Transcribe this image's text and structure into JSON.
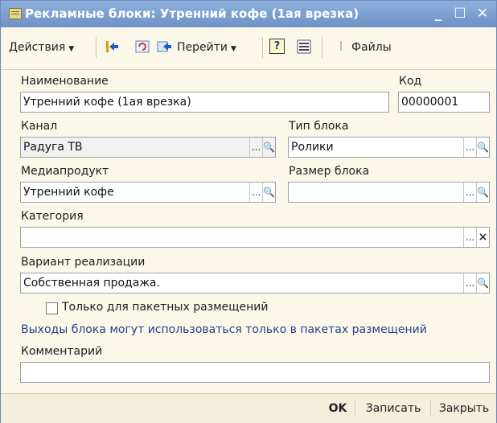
{
  "window": {
    "title": "Рекламные блоки: Утренний кофе (1ая врезка)"
  },
  "titlebar": {
    "minimize_glyph": "_",
    "maximize_glyph": "☐",
    "close_glyph": "✕"
  },
  "toolbar": {
    "actions_label": "Действия",
    "goto_label": "Перейти",
    "help_glyph": "?",
    "files_label": "Файлы"
  },
  "form": {
    "name_label": "Наименование",
    "name_value": "Утренний кофе (1ая врезка)",
    "code_label": "Код",
    "code_value": "00000001",
    "channel_label": "Канал",
    "channel_value": "Радуга ТВ",
    "block_type_label": "Тип блока",
    "block_type_value": "Ролики",
    "mediaproduct_label": "Медиапродукт",
    "mediaproduct_value": "Утренний кофе",
    "block_size_label": "Размер блока",
    "block_size_value": "",
    "category_label": "Категория",
    "category_value": "",
    "sale_variant_label": "Вариант реализации",
    "sale_variant_value": "Собственная продажа.",
    "package_only_label": "Только для пакетных размещений",
    "package_only_checked": false,
    "info_text": "Выходы блока могут использоваться только в пакетах размещений",
    "comment_label": "Комментарий",
    "comment_value": ""
  },
  "buttons": {
    "select_glyph": "...",
    "search_glyph": "🔍",
    "clear_glyph": "×"
  },
  "footer": {
    "ok_label": "OK",
    "save_label": "Записать",
    "close_label": "Закрыть"
  }
}
